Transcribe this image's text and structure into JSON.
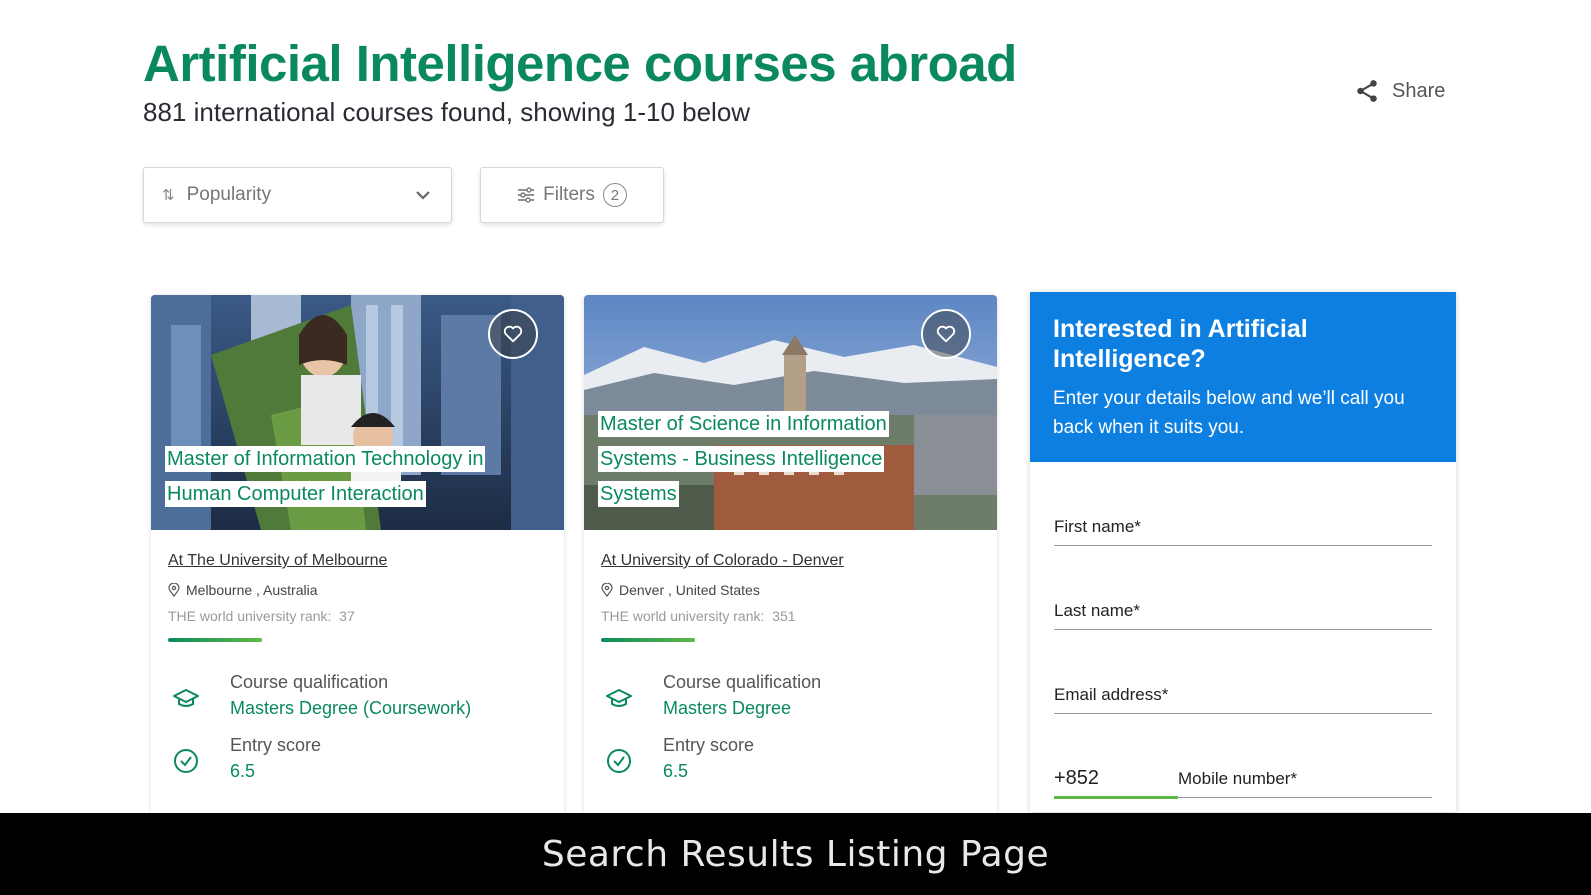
{
  "header": {
    "title": "Artificial Intelligence courses abroad",
    "subtitle": "881 international courses found, showing 1-10 below",
    "share_label": "Share"
  },
  "controls": {
    "sort_value": "Popularity",
    "filters_label": "Filters",
    "filters_count": "2"
  },
  "courses": [
    {
      "title": "Master of Information Technology in Human Computer Interaction",
      "university": "At The University of Melbourne",
      "location": "Melbourne , Australia",
      "rank_label": "THE world university rank:",
      "rank_value": "37",
      "qualification_label": "Course qualification",
      "qualification_value": "Masters Degree (Coursework)",
      "entry_label": "Entry score",
      "entry_value": "6.5"
    },
    {
      "title": "Master of Science in Information Systems - Business Intelligence Systems",
      "university": "At University of Colorado - Denver",
      "location": "Denver , United States",
      "rank_label": "THE world university rank:",
      "rank_value": "351",
      "qualification_label": "Course qualification",
      "qualification_value": "Masters Degree",
      "entry_label": "Entry score",
      "entry_value": "6.5"
    }
  ],
  "lead_form": {
    "title": "Interested in Artificial Intelligence?",
    "description": "Enter your details below and we’ll call you back when it suits you.",
    "first_name_label": "First name*",
    "last_name_label": "Last name*",
    "email_label": "Email address*",
    "phone_code": "+852",
    "mobile_label": "Mobile number*"
  },
  "caption": "Search Results Listing Page",
  "colors": {
    "brand_green": "#0a8a5c",
    "form_blue": "#0d7fe0"
  }
}
